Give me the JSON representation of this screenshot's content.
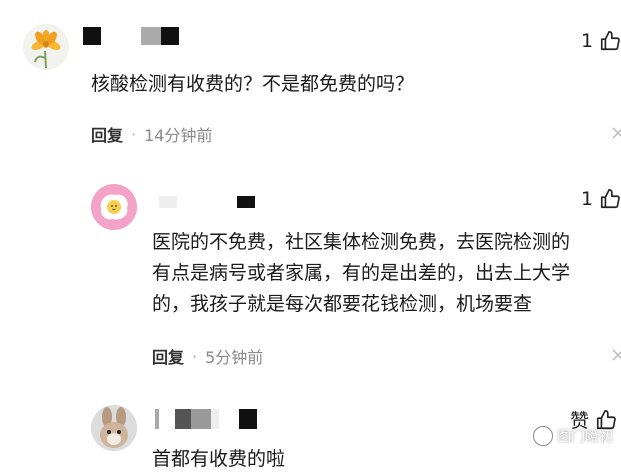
{
  "comments": [
    {
      "text": "核酸检测有收费的？不是都免费的吗？",
      "like_count": "1",
      "reply_label": "回复",
      "time": "14分钟前"
    },
    {
      "lines": [
        "医院的不免费，社区集体检测免费，去医院检测的",
        "有点是病号或者家属，有的是出差的，出去上大学",
        "的，我孩子就是每次都要花钱检测，机场要查"
      ],
      "like_count": "1",
      "reply_label": "回复",
      "time": "5分钟前"
    },
    {
      "like_label": "赞",
      "partial_text": "首都有收费的啦"
    }
  ],
  "watermark": "图门瞪初"
}
